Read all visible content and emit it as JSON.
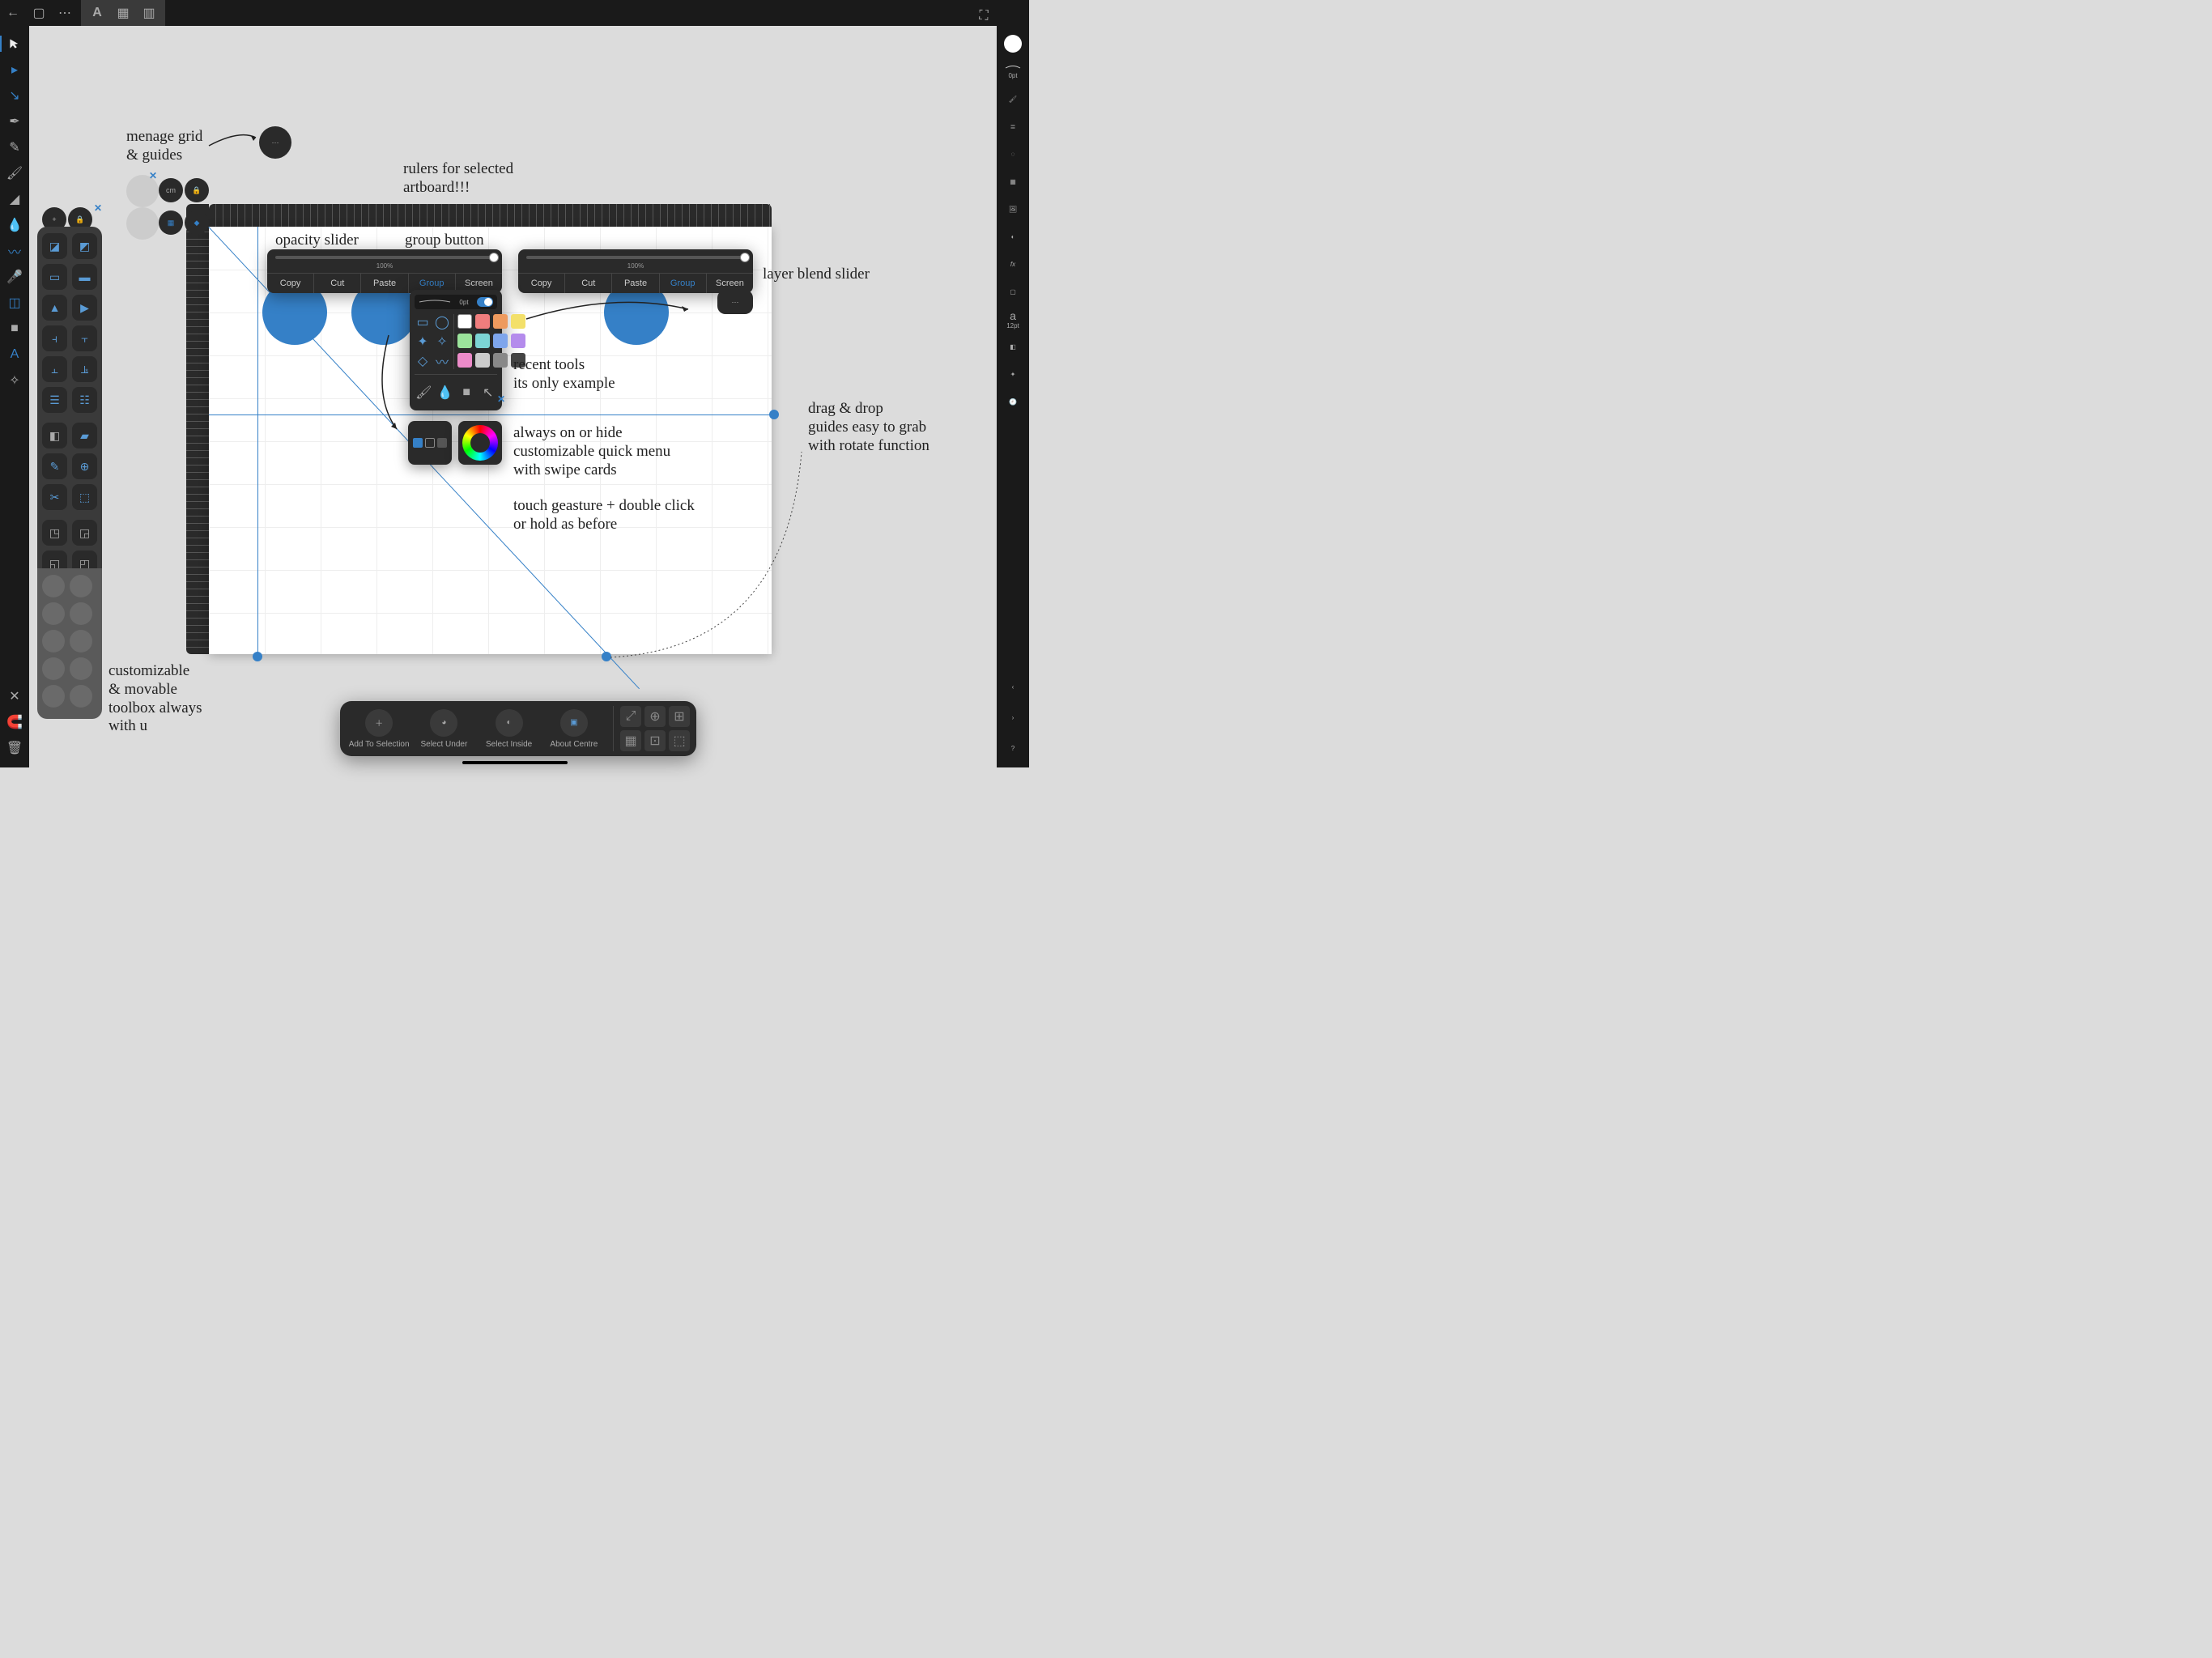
{
  "topbar": {
    "back": "←",
    "doc": "▢",
    "more": "⋯",
    "logo": "A",
    "grid": "▦",
    "panel": "▥",
    "expand": "⛶"
  },
  "left_tools": [
    "move",
    "node",
    "corner",
    "pen",
    "pencil",
    "brush",
    "fill",
    "eyedropper",
    "vector-brush",
    "shape",
    "crop",
    "rect",
    "text",
    "mic"
  ],
  "left_bottom": {
    "close": "✕",
    "magnet": "◎",
    "trash": "🗑"
  },
  "toolbox_float": {
    "add": "+",
    "lock": "🔒"
  },
  "grid_cluster": {
    "more": "⋯",
    "cm_label": "cm",
    "lock": "🔒"
  },
  "ctx1": {
    "slider_pct": "100%",
    "items": [
      "Copy",
      "Cut",
      "Paste",
      "Group",
      "Screen"
    ]
  },
  "ctx2": {
    "slider_pct": "100%",
    "items": [
      "Copy",
      "Cut",
      "Paste",
      "Group",
      "Screen"
    ],
    "more": "⋯"
  },
  "recent": {
    "brush_label": "0pt",
    "swatches": [
      "#ffffff",
      "#ef7d7d",
      "#ee9a5e",
      "#f3e06a",
      "#9be39b",
      "#7cd4d4",
      "#7ea5ec",
      "#b48bec",
      "#ec8bc9",
      "#cccccc",
      "#888888",
      "#444444"
    ]
  },
  "selbar": {
    "add": "Add To Selection",
    "under": "Select Under",
    "inside": "Select Inside",
    "about": "About Centre"
  },
  "anno": {
    "menage": "menage grid\n& guides",
    "rulers": "rulers for selected\nartboard!!!",
    "opacity": "opacity slider",
    "group": "group button",
    "blend": "layer blend slider",
    "recent": "recent tools\nits only example",
    "qm": "always on or hide\ncustomizable quick menu\nwith swipe cards",
    "gesture": "touch geasture + double click\nor hold as before",
    "toolbox": "customizable\n& movable\ntoolbox always\nwith u",
    "guides": "drag & drop\nguides easy to grab\nwith rotate function"
  },
  "right": {
    "stroke_pt": "0pt",
    "font_label": "a",
    "font_size": "12pt"
  }
}
